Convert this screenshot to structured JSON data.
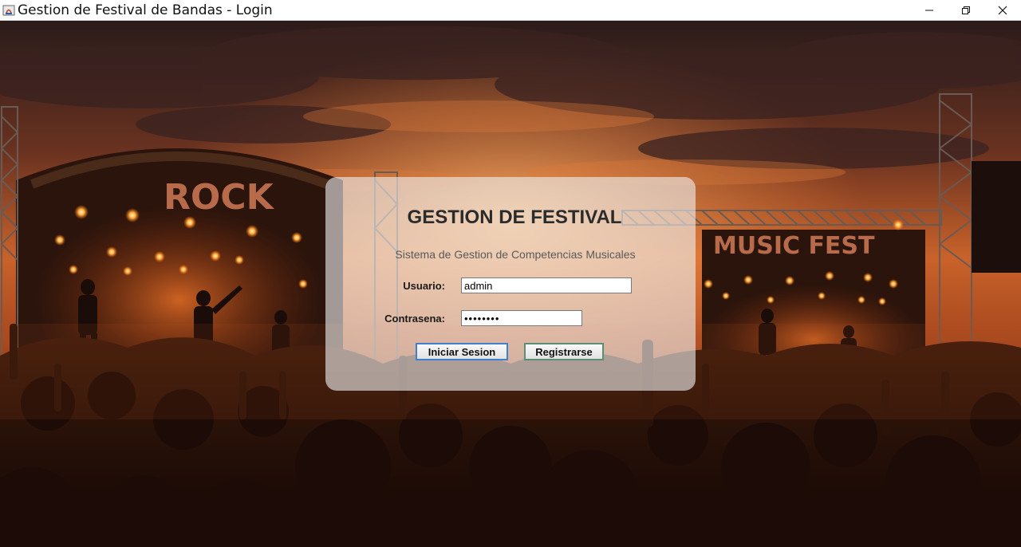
{
  "window": {
    "title": "Gestion de Festival de Bandas - Login",
    "controls": [
      "minimize-icon",
      "restore-icon",
      "close-icon"
    ]
  },
  "scene": {
    "left_stage_sign": "ROCK",
    "right_stage_sign": "MUSIC FEST"
  },
  "login": {
    "title": "GESTION DE FESTIVAL",
    "subtitle": "Sistema de Gestion de Competencias Musicales",
    "username_label": "Usuario:",
    "username_value": "admin",
    "password_label": "Contrasena:",
    "password_value": "••••••••",
    "login_button": "Iniciar Sesion",
    "register_button": "Registrarse"
  },
  "colors": {
    "login_button_border": "#3f7fd0",
    "register_button_border": "#5a8f76"
  }
}
